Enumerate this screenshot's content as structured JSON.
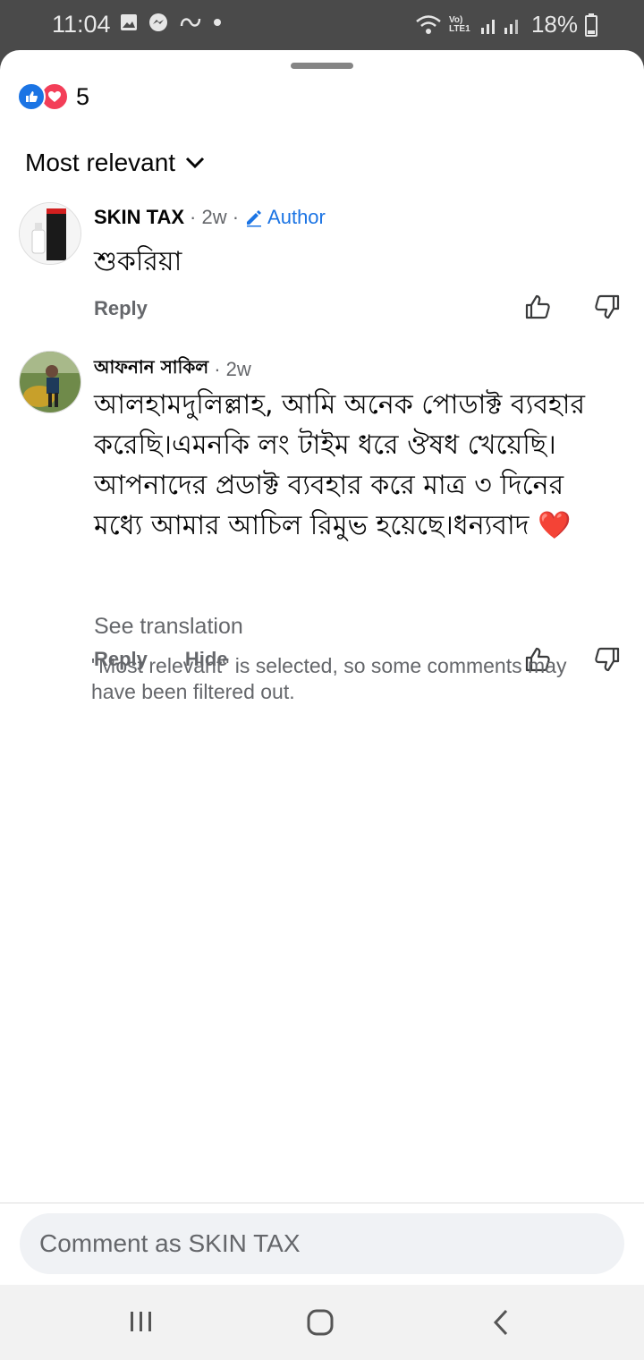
{
  "status_bar": {
    "time": "11:04",
    "battery": "18%",
    "network_label": "Vo) LTE1",
    "left_icons": [
      "gallery-icon",
      "messenger-icon",
      "link-icon",
      "dot-icon"
    ],
    "right_icons": [
      "wifi-icon",
      "signal-icon",
      "battery-icon"
    ]
  },
  "reactions": {
    "count": "5",
    "types": [
      "like",
      "love"
    ]
  },
  "sort": {
    "label": "Most relevant"
  },
  "comments": [
    {
      "author": "SKIN TAX",
      "time": "· 2w ·",
      "badge": "Author",
      "text": "শুকরিয়া",
      "actions": {
        "reply": "Reply"
      }
    },
    {
      "author": "আফনান সাকিল",
      "time": "· 2w",
      "text_lines": [
        "আলহামদুলিল্লাহ, আমি অনেক পোডাক্ট ব্যবহার",
        "করেছি।এমনকি লং টাইম ধরে ঔষধ খেয়েছি।",
        "আপনাদের প্রডাক্ট ব্যবহার করে মাত্র ৩ দিনের",
        "মধ্যে আমার আচিল রিমুভ হয়েছে।ধন্যবাদ"
      ],
      "emoji": "❤️",
      "see_translation": "See translation",
      "actions": {
        "reply": "Reply",
        "hide": "Hide"
      }
    }
  ],
  "filter_note": "\"Most relevant\" is selected, so some comments may have been filtered out.",
  "composer": {
    "placeholder": "Comment as SKIN TAX"
  },
  "colors": {
    "accent": "#1b74e4",
    "love": "#f33e58",
    "secondary_text": "#65676b"
  }
}
